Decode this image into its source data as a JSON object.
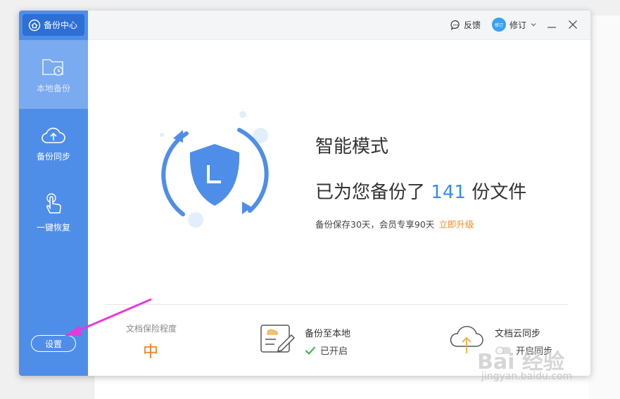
{
  "sidebar": {
    "brand": "备份中心",
    "items": [
      {
        "label": "本地备份",
        "icon": "folder-clock-icon",
        "active": true
      },
      {
        "label": "备份同步",
        "icon": "cloud-upload-icon",
        "active": false
      },
      {
        "label": "一键恢复",
        "icon": "tap-hand-icon",
        "active": false
      }
    ],
    "settings_label": "设置"
  },
  "titlebar": {
    "feedback_label": "反馈",
    "avatar_text": "修订",
    "user_name": "修订"
  },
  "main": {
    "mode_title": "智能模式",
    "backup_prefix": "已为您备份了",
    "backup_count": "141",
    "backup_suffix": "份文件",
    "retention_text": "备份保存30天，会员专享90天",
    "upgrade_label": "立即升级"
  },
  "stats": {
    "protection_label": "文档保险程度",
    "protection_value": "中",
    "local_title": "备份至本地",
    "local_status": "已开启",
    "cloud_title": "文档云同步",
    "cloud_status": "开启同步"
  },
  "colors": {
    "sidebar": "#4f8ee8",
    "accent": "#3d8ae6",
    "orange": "#f07b24"
  },
  "watermark": {
    "brand": "Bai 经验",
    "url": "jingyan.baidu.com"
  }
}
